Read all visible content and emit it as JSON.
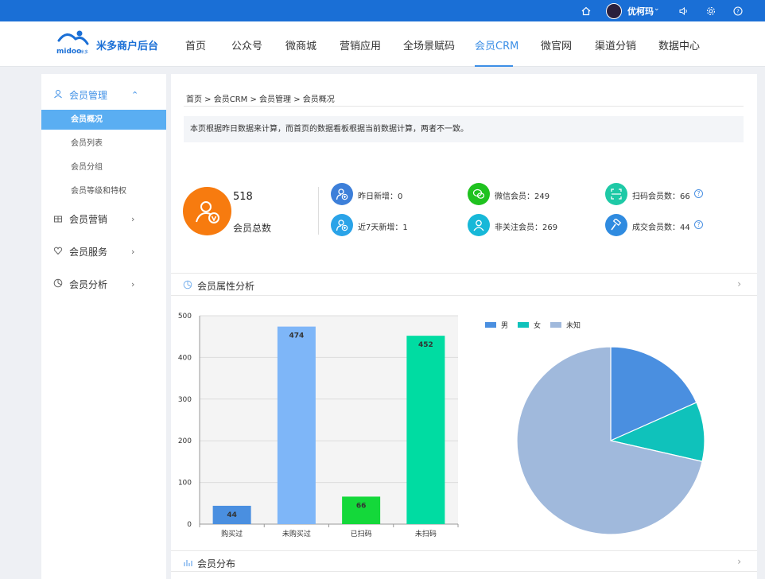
{
  "topbar": {
    "username": "优柯玛",
    "icons": [
      "home-icon",
      "sound-icon",
      "gear-icon",
      "help-icon"
    ]
  },
  "header": {
    "logo_text": "米多商户后台",
    "logo_word": "midoo",
    "logo_sub": "米多",
    "nav": [
      "首页",
      "公众号",
      "微商城",
      "营销应用",
      "全场景赋码",
      "会员CRM",
      "微官网",
      "渠道分销",
      "数据中心"
    ],
    "active_nav": "会员CRM"
  },
  "sidebar": {
    "groups": [
      {
        "label": "会员管理",
        "icon": "user-icon",
        "expanded": true,
        "items": [
          "会员概况",
          "会员列表",
          "会员分组",
          "会员等级和特权"
        ],
        "active_item": "会员概况"
      },
      {
        "label": "会员营销",
        "icon": "gift-icon",
        "expanded": false
      },
      {
        "label": "会员服务",
        "icon": "heart-icon",
        "expanded": false
      },
      {
        "label": "会员分析",
        "icon": "pie-icon",
        "expanded": false
      }
    ]
  },
  "breadcrumb": "首页 > 会员CRM > 会员管理 > 会员概况",
  "notice": "本页根据昨日数据来计算，而首页的数据看板根据当前数据计算，两者不一致。",
  "overview": {
    "total_value": "518",
    "total_label": "会员总数",
    "stats": [
      {
        "label": "昨日新增：",
        "value": "0",
        "color": "#3d7fd9"
      },
      {
        "label": "近7天新增：",
        "value": "1",
        "color": "#2aa3e8"
      },
      {
        "label": "微信会员：",
        "value": "249",
        "color": "#1fc21f"
      },
      {
        "label": "非关注会员：",
        "value": "269",
        "color": "#17b8d8"
      },
      {
        "label": "扫码会员数：",
        "value": "66",
        "color": "#1ec9a6"
      },
      {
        "label": "成交会员数：",
        "value": "44",
        "color": "#2f8be0"
      }
    ]
  },
  "section_attr": {
    "title": "会员属性分析"
  },
  "section_dist": {
    "title": "会员分布"
  },
  "chart_data": [
    {
      "type": "bar",
      "categories": [
        "购买过",
        "未购买过",
        "已扫码",
        "未扫码"
      ],
      "values": [
        44,
        474,
        66,
        452
      ],
      "colors": [
        "#4a8fe0",
        "#7eb6f8",
        "#14d83a",
        "#00dca2"
      ],
      "ylim": [
        0,
        500
      ],
      "yticks": [
        0,
        100,
        200,
        300,
        400,
        500
      ],
      "grid": true
    },
    {
      "type": "pie",
      "labels": [
        "男",
        "女",
        "未知"
      ],
      "values": [
        95,
        53,
        370
      ],
      "colors": [
        "#4a8fe0",
        "#0fc2bb",
        "#a0b9dc"
      ],
      "legend": "top-left"
    }
  ]
}
